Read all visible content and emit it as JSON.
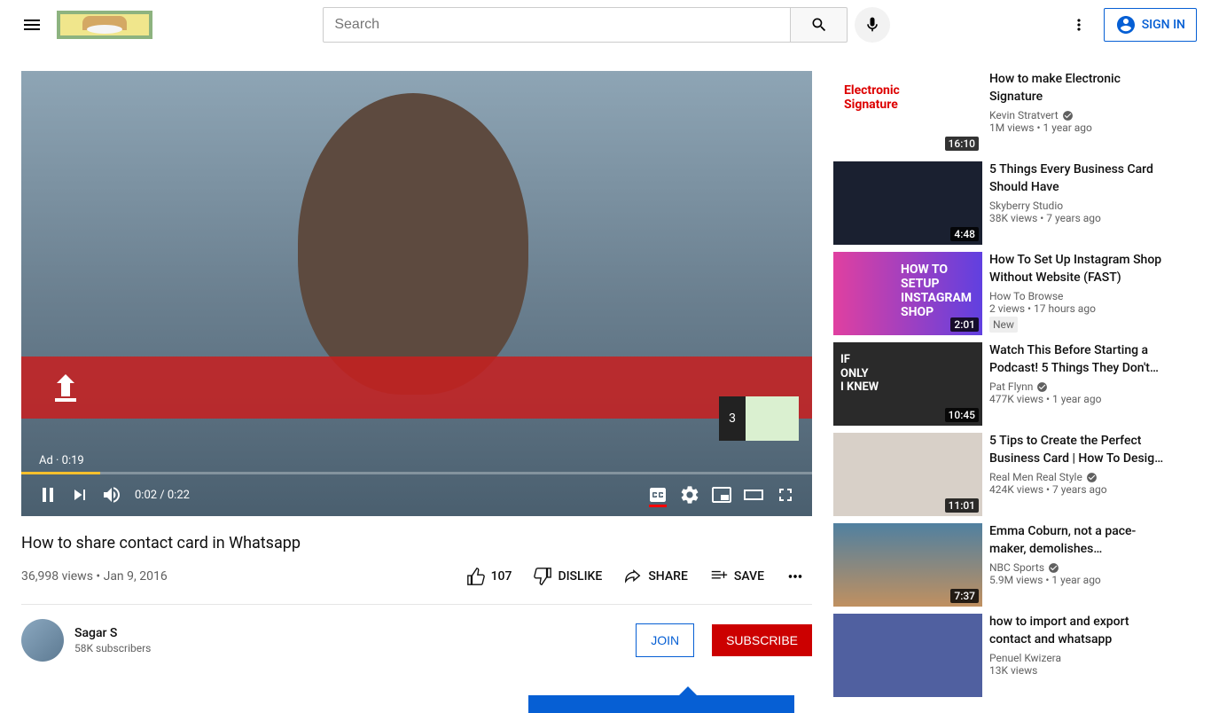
{
  "header": {
    "search_placeholder": "Search",
    "signin_label": "SIGN IN"
  },
  "player": {
    "ad_label": "Ad · 0:19",
    "current_time": "0:02",
    "duration": "0:22",
    "time_display": "0:02 / 0:22",
    "overlay_number": "3"
  },
  "video": {
    "title": "How to share contact card in Whatsapp",
    "views": "36,998 views",
    "date": "Jan 9, 2016",
    "meta": "36,998 views • Jan 9, 2016"
  },
  "actions": {
    "like_count": "107",
    "dislike_label": "DISLIKE",
    "share_label": "SHARE",
    "save_label": "SAVE"
  },
  "channel": {
    "name": "Sagar S",
    "subscribers": "58K subscribers",
    "join_label": "JOIN",
    "subscribe_label": "SUBSCRIBE"
  },
  "related": [
    {
      "title": "How to make Electronic Signature",
      "channel": "Kevin Stratvert",
      "verified": true,
      "views": "1M views",
      "age": "1 year ago",
      "duration": "16:10",
      "thumb_text": "Electronic\nSignature",
      "new": false
    },
    {
      "title": "5 Things Every Business Card Should Have",
      "channel": "Skyberry Studio",
      "verified": false,
      "views": "38K views",
      "age": "7 years ago",
      "duration": "4:48",
      "thumb_text": "",
      "new": false
    },
    {
      "title": "How To Set Up Instagram Shop Without Website (FAST)",
      "channel": "How To Browse",
      "verified": false,
      "views": "2 views",
      "age": "17 hours ago",
      "duration": "2:01",
      "thumb_text": "HOW TO\nSETUP\nINSTAGRAM\nSHOP",
      "new": true
    },
    {
      "title": "Watch This Before Starting a Podcast! 5 Things They Don't…",
      "channel": "Pat Flynn",
      "verified": true,
      "views": "477K views",
      "age": "1 year ago",
      "duration": "10:45",
      "thumb_text": "IF\nONLY\nI KNEW",
      "new": false
    },
    {
      "title": "5 Tips to Create the Perfect Business Card | How To Desig…",
      "channel": "Real Men Real Style",
      "verified": true,
      "views": "424K views",
      "age": "7 years ago",
      "duration": "11:01",
      "thumb_text": "",
      "new": false
    },
    {
      "title": "Emma Coburn, not a pace-maker, demolishes…",
      "channel": "NBC Sports",
      "verified": true,
      "views": "5.9M views",
      "age": "1 year ago",
      "duration": "7:37",
      "thumb_text": "",
      "new": false
    },
    {
      "title": "how to import and export contact and whatsapp",
      "channel": "Penuel Kwizera",
      "verified": false,
      "views": "13K views",
      "age": "",
      "duration": "",
      "thumb_text": "",
      "new": false
    }
  ],
  "new_badge_text": "New"
}
